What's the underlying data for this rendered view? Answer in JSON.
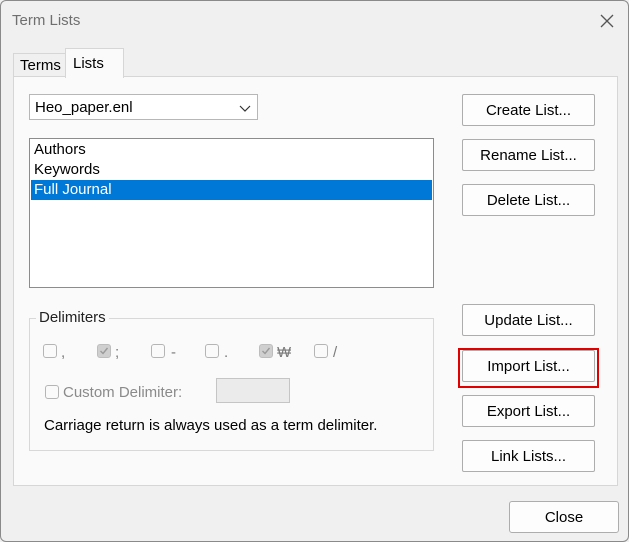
{
  "window": {
    "title": "Term Lists"
  },
  "tabs": [
    {
      "label": "Terms",
      "active": false
    },
    {
      "label": "Lists",
      "active": true
    }
  ],
  "library_select": {
    "value": "Heo_paper.enl"
  },
  "lists": [
    {
      "label": "Authors",
      "selected": false
    },
    {
      "label": "Keywords",
      "selected": false
    },
    {
      "label": "Full Journal",
      "selected": true
    }
  ],
  "buttons": {
    "create": "Create List...",
    "rename": "Rename List...",
    "delete": "Delete List...",
    "update": "Update List...",
    "import": "Import List...",
    "export": "Export List...",
    "link": "Link Lists...",
    "close": "Close"
  },
  "delimiters": {
    "group_label": "Delimiters",
    "options": [
      {
        "symbol": ",",
        "checked": false
      },
      {
        "symbol": ";",
        "checked": true
      },
      {
        "symbol": "-",
        "checked": false
      },
      {
        "symbol": ".",
        "checked": false
      },
      {
        "symbol": "₩",
        "checked": true
      },
      {
        "symbol": "/",
        "checked": false
      }
    ],
    "custom_label": "Custom Delimiter:",
    "custom_value": "",
    "note": "Carriage return is always used as a term delimiter."
  },
  "colors": {
    "selection": "#0078d7",
    "highlight_border": "#e00000"
  }
}
